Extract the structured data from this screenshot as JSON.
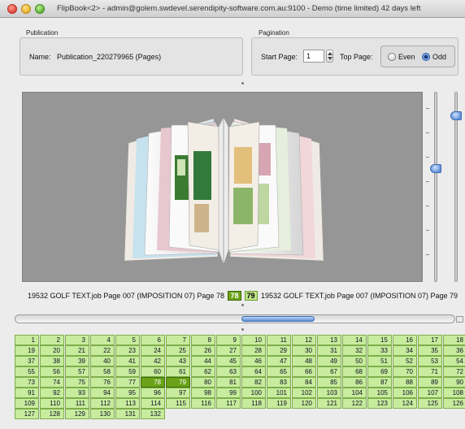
{
  "window": {
    "title": "FlipBook<2> - admin@golem.swdevel.serendipity-software.com.au:9100 - Demo (time limited) 42 days left"
  },
  "publication": {
    "group_label": "Publication",
    "name_label": "Name:",
    "name_value": "Publication_220279965 (Pages)"
  },
  "pagination": {
    "group_label": "Pagination",
    "start_page_label": "Start Page:",
    "start_page_value": "1",
    "top_page_label": "Top Page:",
    "even_label": "Even",
    "odd_label": "Odd",
    "selected": "Odd"
  },
  "page_strip": {
    "left_text": "19532 GOLF  TEXT.job Page 007 (IMPOSITION 07) Page 78",
    "left_badge_a": "78",
    "left_badge_b": "79",
    "right_text": "19532 GOLF  TEXT.job Page 007 (IMPOSITION 07) Page 79"
  },
  "pages": {
    "columns": 18,
    "first": 1,
    "last": 132,
    "selected": [
      78,
      79
    ]
  },
  "colors": {
    "cell_bg": "#c7ec9e",
    "cell_selected": "#6aa218",
    "viewer_bg": "#969696"
  }
}
